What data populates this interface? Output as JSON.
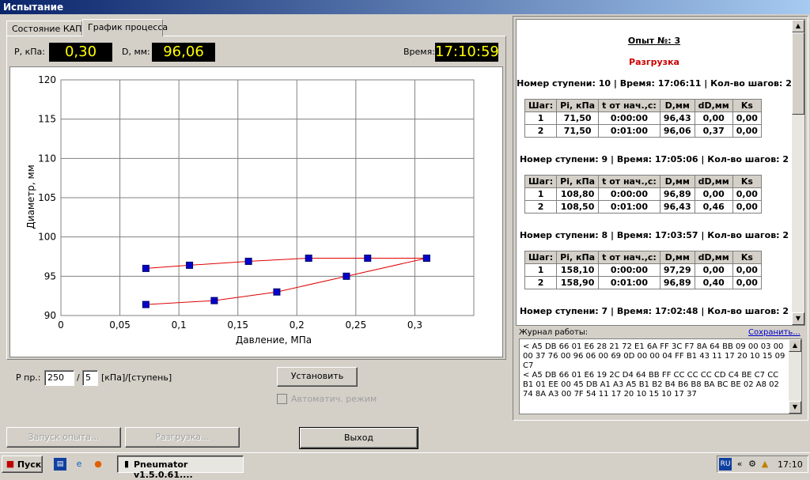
{
  "window": {
    "title": "Испытание"
  },
  "tabs": [
    {
      "label": "Состояние КАП2"
    },
    {
      "label": "График процесса"
    }
  ],
  "readouts": {
    "pressure_label": "P, кПа:",
    "pressure_value": "0,30",
    "diameter_label": "D, мм:",
    "diameter_value": "96,06",
    "time_label": "Время:",
    "time_value": "17:10:59"
  },
  "chart_data": {
    "type": "line",
    "xlabel": "Давление, МПа",
    "ylabel": "Диаметр, мм",
    "xlim": [
      0,
      0.35
    ],
    "ylim": [
      90,
      120
    ],
    "x_ticks": [
      "0",
      "0,05",
      "0,1",
      "0,15",
      "0,2",
      "0,25",
      "0,3"
    ],
    "x_tick_values": [
      0,
      0.05,
      0.1,
      0.15,
      0.2,
      0.25,
      0.3
    ],
    "y_ticks": [
      "90",
      "95",
      "100",
      "105",
      "110",
      "115",
      "120"
    ],
    "y_tick_values": [
      90,
      95,
      100,
      105,
      110,
      115,
      120
    ],
    "grid": true,
    "series": [
      {
        "x": [
          0.072,
          0.13,
          0.183,
          0.242,
          0.31
        ],
        "y": [
          91.4,
          91.9,
          93.0,
          95.0,
          97.3
        ]
      },
      {
        "x": [
          0.072,
          0.109,
          0.159,
          0.21,
          0.26,
          0.31
        ],
        "y": [
          96.0,
          96.4,
          96.9,
          97.3,
          97.3,
          97.3
        ]
      }
    ],
    "line_color": "#e00000",
    "marker_color": "#0000cc"
  },
  "controls": {
    "p_label": "Р пр.:",
    "p_value": "250",
    "slash": "/",
    "steps_value": "5",
    "units": "[кПа]/[ступень]",
    "set_button": "Установить",
    "auto_mode": "Автоматич. режим",
    "start_button": "Запуск опыта...",
    "unload_button": "Разгрузка...",
    "exit_button": "Выход"
  },
  "report": {
    "title": "Опыт №: 3",
    "phase": "Разгрузка",
    "phase_color": "#cc0000",
    "headers": [
      "Шаг:",
      "Pi, кПа",
      "t от нач.,с:",
      "D,мм",
      "dD,мм",
      "Ks"
    ],
    "stages": [
      {
        "title": "Номер ступени: 10 | Время: 17:06:11 | Кол-во шагов: 2",
        "rows": [
          [
            "1",
            "71,50",
            "0:00:00",
            "96,43",
            "0,00",
            "0,00"
          ],
          [
            "2",
            "71,50",
            "0:01:00",
            "96,06",
            "0,37",
            "0,00"
          ]
        ]
      },
      {
        "title": "Номер ступени: 9 | Время: 17:05:06 | Кол-во шагов: 2",
        "rows": [
          [
            "1",
            "108,80",
            "0:00:00",
            "96,89",
            "0,00",
            "0,00"
          ],
          [
            "2",
            "108,50",
            "0:01:00",
            "96,43",
            "0,46",
            "0,00"
          ]
        ]
      },
      {
        "title": "Номер ступени: 8 | Время: 17:03:57 | Кол-во шагов: 2",
        "rows": [
          [
            "1",
            "158,10",
            "0:00:00",
            "97,29",
            "0,00",
            "0,00"
          ],
          [
            "2",
            "158,90",
            "0:01:00",
            "96,89",
            "0,40",
            "0,00"
          ]
        ]
      },
      {
        "title": "Номер ступени: 7 | Время: 17:02:48 | Кол-во шагов: 2",
        "rows": []
      }
    ]
  },
  "log": {
    "label": "Журнал работы:",
    "save_link": "Сохранить...",
    "text": "< A5 DB 66 01 E6 28 21 72 E1 6A FF 3C F7 8A 64 BB 09 00 03 00 00 37 76 00 96 06 00 69 0D 00 00 04 FF B1 43 11 17 20 10 15 09 C7\n< A5 DB 66 01 E6 19 2C D4 64 BB FF CC CC CC CD C4 BE C7 CC B1 01 EE 00 45 DB A1 A3 A5 B1 B2 B4 B6 B8 BA BC BE 02 A8 02 74 8A A3 00 7F 54 11 17 20 10 15 10 17 37"
  },
  "taskbar": {
    "start": "Пуск",
    "app": "Pneumator v1.5.0.61....",
    "lang": "RU",
    "clock": "17:10"
  }
}
